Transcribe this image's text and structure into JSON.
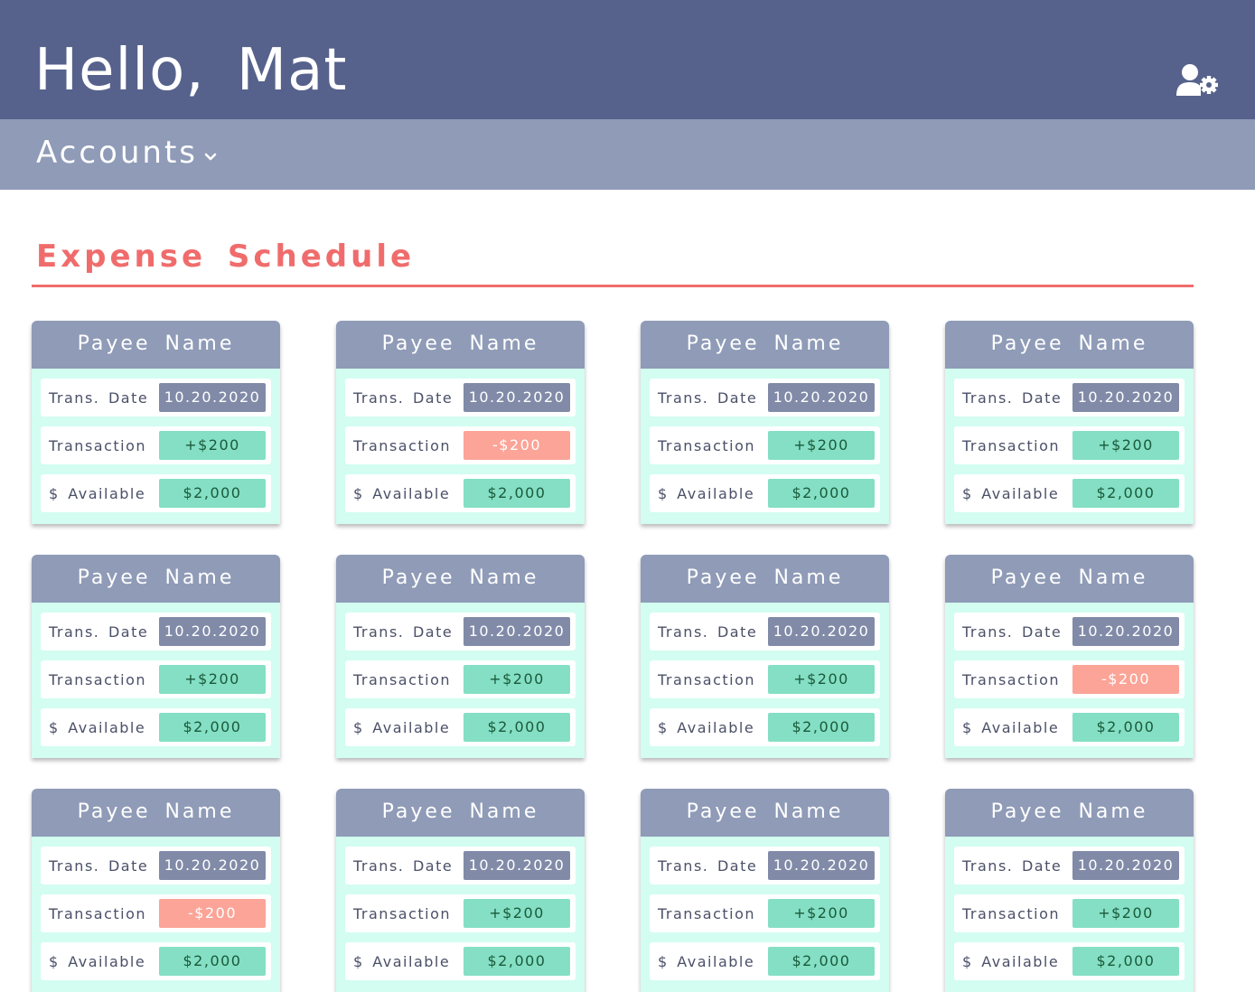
{
  "header": {
    "greeting": "Hello, Mat",
    "settings_icon": "user-gear-icon"
  },
  "nav": {
    "accounts_label": "Accounts",
    "accounts_icon": "chevron-down-icon"
  },
  "section": {
    "title": "Expense Schedule"
  },
  "labels": {
    "payee": "Payee Name",
    "trans_date": "Trans. Date",
    "transaction": "Transaction",
    "available": "$ Available"
  },
  "colors": {
    "header_bg": "#56628c",
    "subnav_bg": "#8f9bb7",
    "accent": "#f06c6c",
    "card_bg": "#d2fdf0",
    "positive": "#84dfc4",
    "negative": "#fba497",
    "date_pill": "#818ba8"
  },
  "cards": [
    {
      "payee": "Payee Name",
      "date": "10.20.2020",
      "transaction": "+$200",
      "type": "positive",
      "available": "$2,000"
    },
    {
      "payee": "Payee Name",
      "date": "10.20.2020",
      "transaction": "-$200",
      "type": "negative",
      "available": "$2,000"
    },
    {
      "payee": "Payee Name",
      "date": "10.20.2020",
      "transaction": "+$200",
      "type": "positive",
      "available": "$2,000"
    },
    {
      "payee": "Payee Name",
      "date": "10.20.2020",
      "transaction": "+$200",
      "type": "positive",
      "available": "$2,000"
    },
    {
      "payee": "Payee Name",
      "date": "10.20.2020",
      "transaction": "+$200",
      "type": "positive",
      "available": "$2,000"
    },
    {
      "payee": "Payee Name",
      "date": "10.20.2020",
      "transaction": "+$200",
      "type": "positive",
      "available": "$2,000"
    },
    {
      "payee": "Payee Name",
      "date": "10.20.2020",
      "transaction": "+$200",
      "type": "positive",
      "available": "$2,000"
    },
    {
      "payee": "Payee Name",
      "date": "10.20.2020",
      "transaction": "-$200",
      "type": "negative",
      "available": "$2,000"
    },
    {
      "payee": "Payee Name",
      "date": "10.20.2020",
      "transaction": "-$200",
      "type": "negative",
      "available": "$2,000"
    },
    {
      "payee": "Payee Name",
      "date": "10.20.2020",
      "transaction": "+$200",
      "type": "positive",
      "available": "$2,000"
    },
    {
      "payee": "Payee Name",
      "date": "10.20.2020",
      "transaction": "+$200",
      "type": "positive",
      "available": "$2,000"
    },
    {
      "payee": "Payee Name",
      "date": "10.20.2020",
      "transaction": "+$200",
      "type": "positive",
      "available": "$2,000"
    }
  ]
}
